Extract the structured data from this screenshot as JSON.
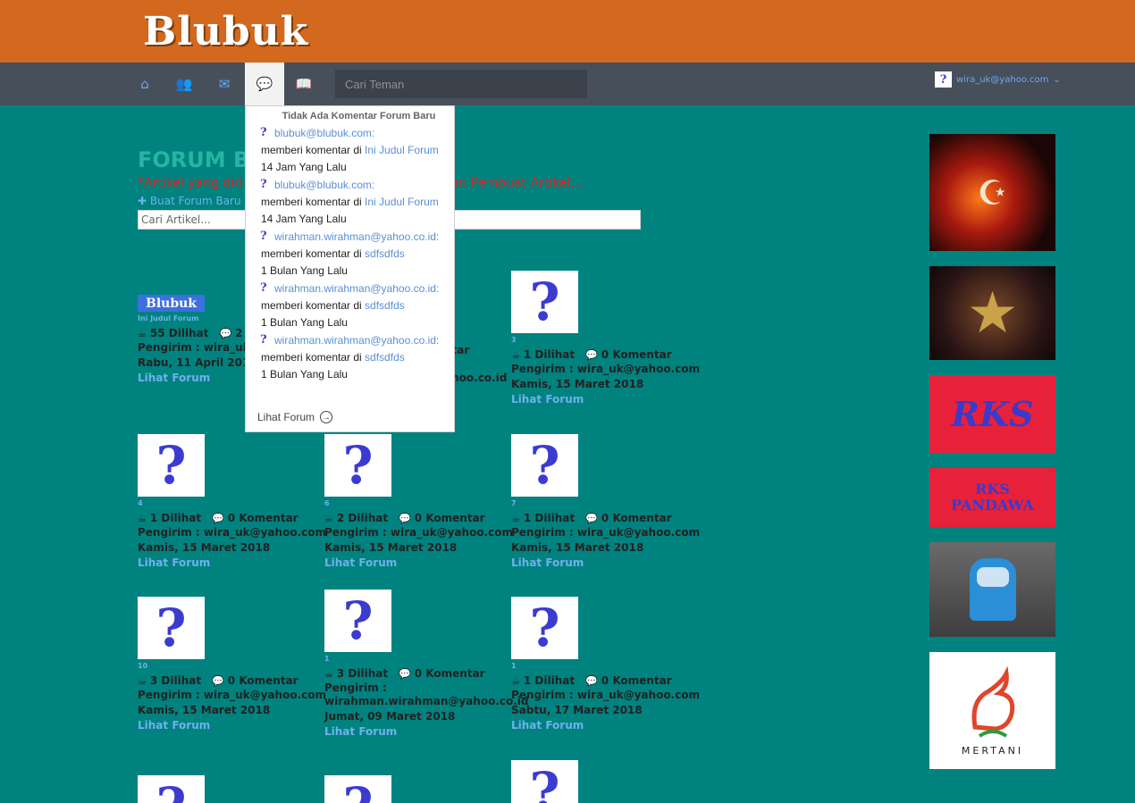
{
  "header": {
    "logo": "Blubuk"
  },
  "nav": {
    "icons": [
      "home-icon",
      "friends-icon",
      "mail-icon",
      "forum-chat-icon",
      "articles-book-icon"
    ],
    "search_placeholder": "Cari Teman",
    "user_email": "wira_uk@yahoo.com",
    "user_caret": "⌄"
  },
  "main": {
    "title": "FORUM BL",
    "notice": "*Artikel yang diri",
    "notice_right": "ibadi dari Pembuat Artikel...",
    "new_forum": "Buat Forum Baru",
    "article_search_placeholder": "Cari Artikel..."
  },
  "dropdown": {
    "header": "Tidak Ada Komentar Forum Baru",
    "items": [
      {
        "user": "blubuk@blubuk.com:",
        "prefix": "memberi komentar di ",
        "target": "Ini Judul Forum",
        "time": "14 Jam Yang Lalu"
      },
      {
        "user": "blubuk@blubuk.com:",
        "prefix": "memberi komentar di ",
        "target": "Ini Judul Forum",
        "time": "14 Jam Yang Lalu"
      },
      {
        "user": "wirahman.wirahman@yahoo.co.id:",
        "prefix": "memberi komentar di ",
        "target": "sdfsdfds",
        "time": "1 Bulan Yang Lalu"
      },
      {
        "user": "wirahman.wirahman@yahoo.co.id:",
        "prefix": "memberi komentar di ",
        "target": "sdfsdfds",
        "time": "1 Bulan Yang Lalu"
      },
      {
        "user": "wirahman.wirahman@yahoo.co.id:",
        "prefix": "memberi komentar di ",
        "target": "sdfsdfds",
        "time": "1 Bulan Yang Lalu"
      }
    ],
    "footer": "Lihat Forum"
  },
  "cards": [
    {
      "title": "Ini Judul Forum",
      "views": "55 Dilihat",
      "comments": "2 K",
      "sender": "Pengirim : wira_uk@",
      "date": "Rabu, 11 April 2018",
      "link": "Lihat Forum",
      "logo": "Blubuk"
    },
    {
      "title": "",
      "views": "",
      "comments": "ntar",
      "sender": "ahoo.co.id",
      "date": "",
      "link": ""
    },
    {
      "title": "3",
      "views": "1 Dilihat",
      "comments": "0 Komentar",
      "sender": "Pengirim : wira_uk@yahoo.com",
      "date": "Kamis, 15 Maret 2018",
      "link": "Lihat Forum"
    },
    {
      "title": "4",
      "views": "1 Dilihat",
      "comments": "0 Komentar",
      "sender": "Pengirim : wira_uk@yahoo.com",
      "date": "Kamis, 15 Maret 2018",
      "link": "Lihat Forum"
    },
    {
      "title": "6",
      "views": "2 Dilihat",
      "comments": "0 Komentar",
      "sender": "Pengirim : wira_uk@yahoo.com",
      "date": "Kamis, 15 Maret 2018",
      "link": "Lihat Forum"
    },
    {
      "title": "7",
      "views": "1 Dilihat",
      "comments": "0 Komentar",
      "sender": "Pengirim : wira_uk@yahoo.com",
      "date": "Kamis, 15 Maret 2018",
      "link": "Lihat Forum"
    },
    {
      "title": "10",
      "views": "3 Dilihat",
      "comments": "0 Komentar",
      "sender": "Pengirim : wira_uk@yahoo.com",
      "date": "Kamis, 15 Maret 2018",
      "link": "Lihat Forum"
    },
    {
      "title": "1",
      "views": "3 Dilihat",
      "comments": "0 Komentar",
      "sender": "Pengirim : wirahman.wirahman@yahoo.co.id",
      "date": "Jumat, 09 Maret 2018",
      "link": "Lihat Forum"
    },
    {
      "title": "1",
      "views": "1 Dilihat",
      "comments": "0 Komentar",
      "sender": "Pengirim : wira_uk@yahoo.com",
      "date": "Sabtu, 17 Maret 2018",
      "link": "Lihat Forum"
    }
  ],
  "ads": [
    {
      "name": "ad-allah-calligraphy",
      "colors": [
        "#3a0a0a",
        "#e0531a"
      ]
    },
    {
      "name": "ad-muhammad-star",
      "colors": [
        "#1a0d0d",
        "#8a6a2a"
      ]
    },
    {
      "name": "ad-rks",
      "text": "RKS",
      "bg": "#e8213a",
      "fg": "#3a3acc"
    },
    {
      "name": "ad-rks-pandawa",
      "text": "RKS PANDAWA",
      "bg": "#e8213a",
      "fg": "#3a3acc"
    },
    {
      "name": "ad-bajaj-photo",
      "colors": [
        "#5a5a5a",
        "#2a8fd6"
      ]
    },
    {
      "name": "ad-mertani",
      "text": "MERTANI",
      "bg": "#ffffff",
      "fg": "#222222"
    }
  ]
}
